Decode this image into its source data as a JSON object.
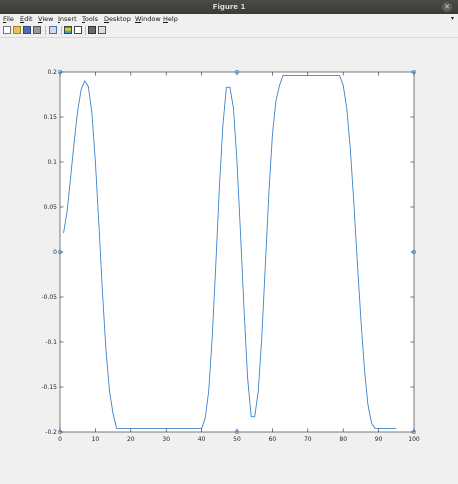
{
  "window": {
    "title": "Figure 1"
  },
  "menu": [
    {
      "label": "File",
      "key": "F"
    },
    {
      "label": "Edit",
      "key": "E"
    },
    {
      "label": "View",
      "key": "V"
    },
    {
      "label": "Insert",
      "key": "I"
    },
    {
      "label": "Tools",
      "key": "T"
    },
    {
      "label": "Desktop",
      "key": "D"
    },
    {
      "label": "Window",
      "key": "W"
    },
    {
      "label": "Help",
      "key": "H"
    }
  ],
  "toolbar": [
    "new-figure-icon",
    "open-file-icon",
    "save-icon",
    "print-icon",
    "link-plot-icon",
    "insert-colorbar-icon",
    "insert-legend-icon",
    "hide-plot-tools-icon",
    "show-plot-tools-icon"
  ],
  "colors": {
    "line": "#3c82c8",
    "axes": "#262626",
    "background": "#ffffff"
  },
  "chart_data": {
    "type": "line",
    "title": "",
    "xlabel": "",
    "ylabel": "",
    "xlim": [
      0,
      100
    ],
    "ylim": [
      -0.2,
      0.2
    ],
    "xticks": [
      0,
      10,
      20,
      30,
      40,
      50,
      60,
      70,
      80,
      90,
      100
    ],
    "yticks": [
      -0.2,
      -0.15,
      -0.1,
      -0.05,
      0,
      0.05,
      0.1,
      0.15,
      0.2
    ],
    "grid": false,
    "series": [
      {
        "x": [
          1,
          2,
          3,
          4,
          5,
          6,
          7,
          8,
          9,
          10,
          11,
          12,
          13,
          14,
          15,
          16,
          17,
          18,
          19,
          20,
          21,
          22,
          23,
          24,
          25,
          26,
          27,
          28,
          29,
          30,
          31,
          32,
          33,
          34,
          35,
          36,
          37,
          38,
          39,
          40,
          41,
          42,
          43,
          44,
          45,
          46,
          47,
          48,
          49,
          50,
          51,
          52,
          53,
          54,
          55,
          56,
          57,
          58,
          59,
          60,
          61,
          62,
          63,
          64,
          65,
          66,
          67,
          68,
          69,
          70,
          71,
          72,
          73,
          74,
          75,
          76,
          77,
          78,
          79,
          80,
          81,
          82,
          83,
          84,
          85,
          86,
          87,
          88,
          89,
          90,
          91,
          92,
          93,
          94,
          95
        ],
        "y": [
          0.021,
          0.045,
          0.083,
          0.122,
          0.157,
          0.181,
          0.19,
          0.184,
          0.155,
          0.1,
          0.03,
          -0.045,
          -0.11,
          -0.155,
          -0.18,
          -0.196,
          -0.196,
          -0.196,
          -0.196,
          -0.196,
          -0.196,
          -0.196,
          -0.196,
          -0.196,
          -0.196,
          -0.196,
          -0.196,
          -0.196,
          -0.196,
          -0.196,
          -0.196,
          -0.196,
          -0.196,
          -0.196,
          -0.196,
          -0.196,
          -0.196,
          -0.196,
          -0.196,
          -0.196,
          -0.185,
          -0.155,
          -0.095,
          -0.015,
          0.07,
          0.14,
          0.183,
          0.183,
          0.16,
          0.1,
          0.02,
          -0.065,
          -0.14,
          -0.183,
          -0.183,
          -0.155,
          -0.095,
          -0.015,
          0.065,
          0.13,
          0.168,
          0.185,
          0.196,
          0.196,
          0.196,
          0.196,
          0.196,
          0.196,
          0.196,
          0.196,
          0.196,
          0.196,
          0.196,
          0.196,
          0.196,
          0.196,
          0.196,
          0.196,
          0.196,
          0.185,
          0.16,
          0.115,
          0.055,
          -0.012,
          -0.075,
          -0.13,
          -0.17,
          -0.19,
          -0.196,
          -0.196,
          -0.196,
          -0.196,
          -0.196,
          -0.196,
          -0.196
        ]
      }
    ],
    "markers": [
      {
        "x": 0,
        "y": 0.2
      },
      {
        "x": 50,
        "y": 0.2
      },
      {
        "x": 100,
        "y": 0.2
      },
      {
        "x": 0,
        "y": 0
      },
      {
        "x": 100,
        "y": 0
      },
      {
        "x": 0,
        "y": -0.2
      },
      {
        "x": 50,
        "y": -0.2
      },
      {
        "x": 100,
        "y": -0.2
      }
    ]
  }
}
